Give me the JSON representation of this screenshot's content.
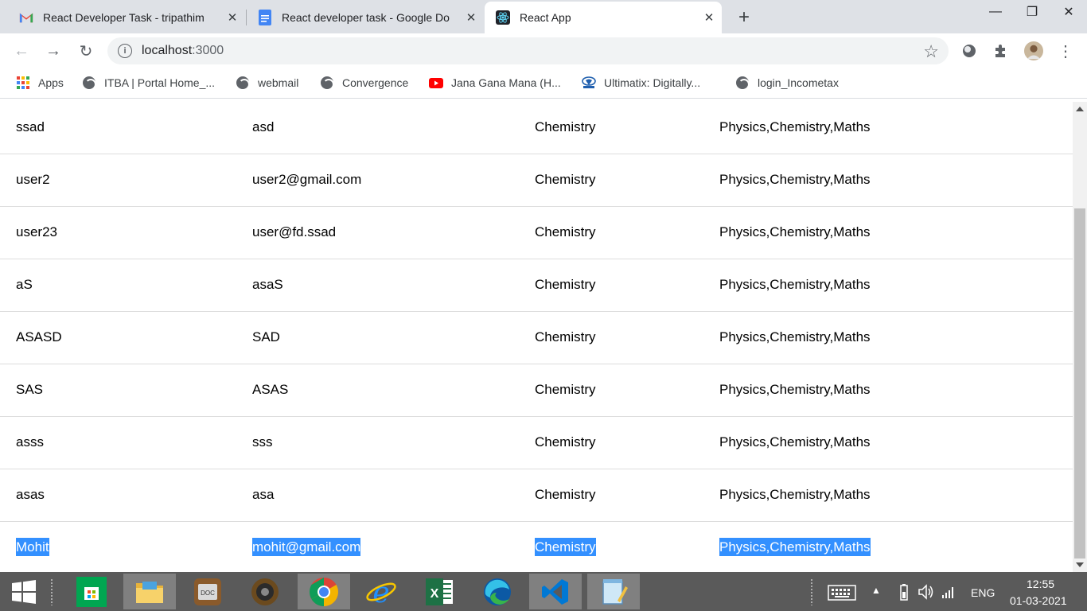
{
  "browser": {
    "tabs": [
      {
        "title": "React Developer Task - tripathim",
        "icon": "gmail-icon"
      },
      {
        "title": "React developer task - Google Do",
        "icon": "google-docs-icon"
      },
      {
        "title": "React App",
        "icon": "react-icon",
        "active": true
      }
    ],
    "new_tab_symbol": "+",
    "window_controls": {
      "minimize": "—",
      "restore": "❐",
      "close": "✕"
    },
    "close_symbol": "✕"
  },
  "toolbar": {
    "back": "←",
    "forward": "→",
    "reload": "↻",
    "url_host": "localhost",
    "url_port": ":3000",
    "info_symbol": "i",
    "star_symbol": "☆"
  },
  "bookmarks": [
    {
      "label": "Apps",
      "icon": "apps-grid-icon"
    },
    {
      "label": "ITBA | Portal Home_...",
      "icon": "globe-icon"
    },
    {
      "label": "webmail",
      "icon": "globe-icon"
    },
    {
      "label": "Convergence",
      "icon": "globe-icon"
    },
    {
      "label": "Jana Gana Mana (H...",
      "icon": "youtube-icon"
    },
    {
      "label": "Ultimatix: Digitally...",
      "icon": "tata-icon"
    },
    {
      "label": "login_Incometax",
      "icon": "globe-icon"
    }
  ],
  "table": {
    "rows": [
      [
        "ssad",
        "asd",
        "Chemistry",
        "Physics,Chemistry,Maths"
      ],
      [
        "user2",
        "user2@gmail.com",
        "Chemistry",
        "Physics,Chemistry,Maths"
      ],
      [
        "user23",
        "user@fd.ssad",
        "Chemistry",
        "Physics,Chemistry,Maths"
      ],
      [
        "aS",
        "asaS",
        "Chemistry",
        "Physics,Chemistry,Maths"
      ],
      [
        "ASASD",
        "SAD",
        "Chemistry",
        "Physics,Chemistry,Maths"
      ],
      [
        "SAS",
        "ASAS",
        "Chemistry",
        "Physics,Chemistry,Maths"
      ],
      [
        "asss",
        "sss",
        "Chemistry",
        "Physics,Chemistry,Maths"
      ],
      [
        "asas",
        "asa",
        "Chemistry",
        "Physics,Chemistry,Maths"
      ],
      [
        "Mohit",
        "mohit@gmail.com",
        "Chemistry",
        "Physics,Chemistry,Maths"
      ]
    ]
  },
  "taskbar": {
    "items": [
      "windows-start-icon",
      "store-icon",
      "file-explorer-icon",
      "doc-app-icon",
      "speaker-app-icon",
      "chrome-icon",
      "internet-explorer-icon",
      "excel-icon",
      "edge-icon",
      "vscode-icon",
      "notepad-icon"
    ],
    "language": "ENG",
    "time": "12:55",
    "date": "01-03-2021"
  },
  "colors": {
    "selection": "#3390ff",
    "tab_strip": "#dee1e6",
    "taskbar": "#5a5a5a"
  }
}
